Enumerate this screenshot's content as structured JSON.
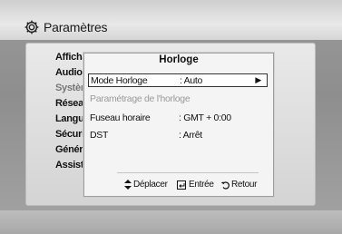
{
  "header": {
    "title": "Paramètres",
    "icon": "gear-icon"
  },
  "menu": {
    "items": [
      {
        "label": "Affichage",
        "dim": false
      },
      {
        "label": "Audio",
        "dim": false
      },
      {
        "label": "Système",
        "dim": true
      },
      {
        "label": "Réseau",
        "dim": false
      },
      {
        "label": "Langue",
        "dim": false
      },
      {
        "label": "Sécurité",
        "dim": false
      },
      {
        "label": "Général",
        "dim": false
      },
      {
        "label": "Assistance",
        "dim": false
      }
    ]
  },
  "dialog": {
    "title": "Horloge",
    "rows": [
      {
        "label": "Mode Horloge",
        "value": ": Auto",
        "selected": true,
        "disabled": false
      },
      {
        "label": "Paramétrage de l'horloge",
        "value": "",
        "selected": false,
        "disabled": true
      },
      {
        "label": "Fuseau horaire",
        "value": ": GMT + 0:00",
        "selected": false,
        "disabled": false
      },
      {
        "label": "DST",
        "value": ": Arrêt",
        "selected": false,
        "disabled": false
      }
    ],
    "footer": {
      "move_label": "Déplacer",
      "enter_label": "Entrée",
      "return_label": "Retour"
    }
  }
}
